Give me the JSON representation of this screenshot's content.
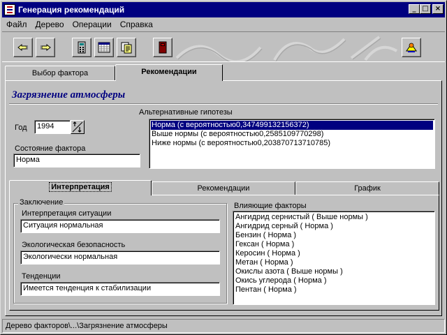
{
  "window": {
    "title": "Генерация рекомендаций",
    "controls": {
      "minimize": "_",
      "maximize": "□",
      "close": "×"
    }
  },
  "menu": [
    "Файл",
    "Дерево",
    "Операции",
    "Справка"
  ],
  "toolbar": {
    "buttons": [
      "back-arrow-icon",
      "forward-arrow-icon",
      "calculator-icon",
      "calendar-icon",
      "copy-document-icon",
      "book-icon",
      "help-icon"
    ]
  },
  "top_tabs": [
    "Выбор фактора",
    "Рекомендации"
  ],
  "factor_title": "Загрязнение атмосферы",
  "year": {
    "label": "Год",
    "value": "1994"
  },
  "factor_state": {
    "label": "Состояние фактора",
    "value": "Норма"
  },
  "hypotheses": {
    "label": "Альтернативные гипотезы",
    "items": [
      "Норма (с вероятностью0,347499132156372)",
      "Выше нормы (с вероятностью0,2585109770298)",
      "Ниже нормы (с вероятностью0,203870713710785)"
    ]
  },
  "inner_tabs": [
    "Интерпретация",
    "Рекомендации",
    "График"
  ],
  "conclusion": {
    "legend": "Заключение",
    "situation": {
      "label": "Интерпретация ситуации",
      "value": "Ситуация нормальная"
    },
    "safety": {
      "label": "Экологическая безопасность",
      "value": "Экологически нормальная"
    },
    "trends": {
      "label": "Тенденции",
      "value": "Имеется тенденция к стабилизации"
    }
  },
  "influencing": {
    "label": "Влияющие факторы",
    "items": [
      "Ангидрид сернистый   ( Выше нормы )",
      "Ангидрид серный   ( Норма )",
      "Бензин   ( Норма )",
      "Гексан   ( Норма )",
      "Керосин   ( Норма )",
      "Метан   ( Норма )",
      "Окислы азота   ( Выше нормы )",
      "Окись углерода   ( Норма )",
      "Пентан   ( Норма )"
    ]
  },
  "status": "Дерево факторов\\...\\Загрязнение атмосферы",
  "colors": {
    "title_bar": "#000080",
    "selection": "#000080",
    "heading": "#000080",
    "face": "#c0c0c0"
  }
}
